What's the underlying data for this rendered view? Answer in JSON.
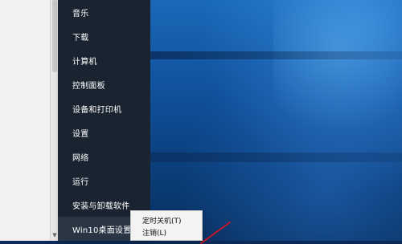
{
  "start_menu": {
    "items": [
      {
        "label": "音乐"
      },
      {
        "label": "下载"
      },
      {
        "label": "计算机"
      },
      {
        "label": "控制面板"
      },
      {
        "label": "设备和打印机"
      },
      {
        "label": "设置"
      },
      {
        "label": "网络"
      },
      {
        "label": "运行"
      },
      {
        "label": "安装与卸载软件"
      },
      {
        "label": "Win10桌面设置"
      }
    ],
    "active_item_index": 9,
    "chevron_glyph": ">"
  },
  "submenu": {
    "items": [
      {
        "label": "定时关机(T)"
      },
      {
        "label": "注销(L)"
      }
    ]
  },
  "colors": {
    "start_panel_bg": "#1a2430",
    "menu_text": "#ffffff",
    "submenu_bg": "#f3f3f3",
    "annotation_arrow": "#c0182a"
  },
  "icons": {
    "scroll_down": "chevron-down-icon",
    "annotation": "red-arrow-icon"
  }
}
